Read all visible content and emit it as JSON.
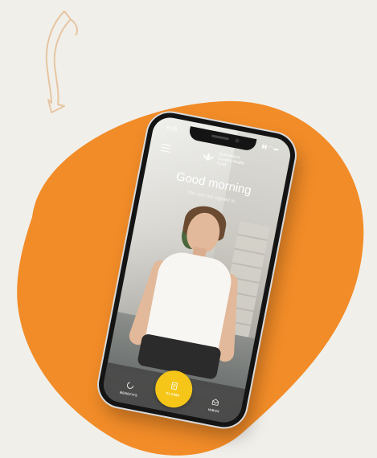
{
  "status_bar": {
    "time": "8:25",
    "icons": "▮▮ ◠ ▬"
  },
  "header": {
    "logo_text": "Queensland Country Health Fund",
    "menu_icon": "hamburger-menu-icon"
  },
  "hero": {
    "greeting": "Good morning",
    "subtitle": "You are not signed in"
  },
  "tabbar": {
    "items": [
      {
        "label": "BENEFITS",
        "icon": "benefits-icon"
      },
      {
        "label": "CLAIMS",
        "icon": "claims-icon"
      },
      {
        "label": "INBOX",
        "icon": "inbox-icon"
      }
    ]
  },
  "colors": {
    "background": "#f1efea",
    "blob": "#f28c28",
    "arrow": "#e6c6a2",
    "claims_button": "#f5c518",
    "tabbar": "#464846"
  }
}
